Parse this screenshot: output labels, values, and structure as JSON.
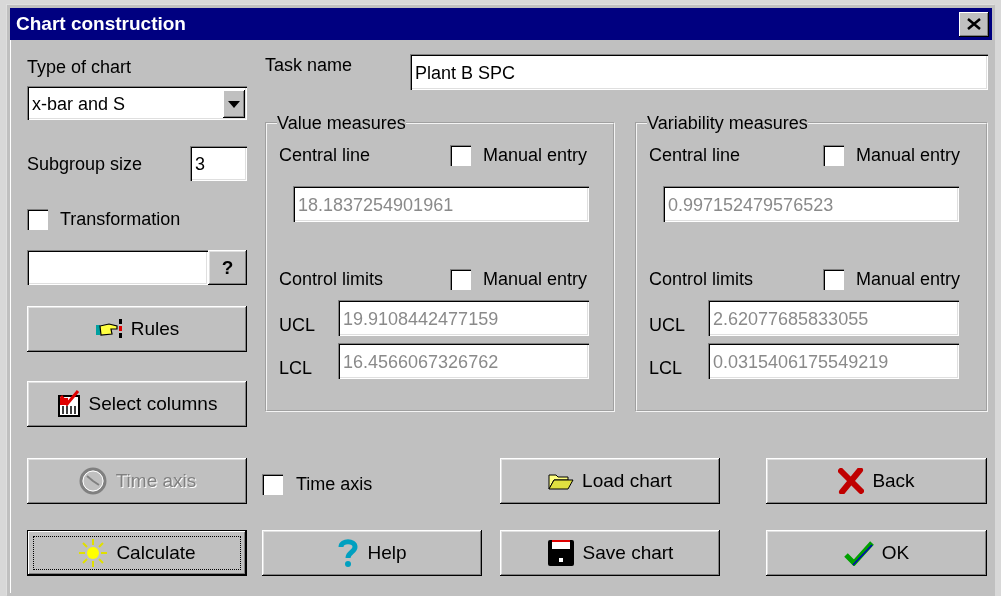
{
  "window": {
    "title": "Chart construction"
  },
  "chart_type": {
    "label": "Type of chart",
    "value": "x-bar and S"
  },
  "subgroup_size": {
    "label": "Subgroup size",
    "value": "3"
  },
  "transformation": {
    "label": "Transformation",
    "checked": false,
    "help": "?"
  },
  "side_buttons": [
    {
      "label": "Rules"
    },
    {
      "label": "Select columns"
    }
  ],
  "task_name": {
    "label": "Task name",
    "value": "Plant B SPC"
  },
  "groups": [
    {
      "title": "Value measures",
      "central_line": "Central line",
      "central_manual": {
        "label": "Manual entry",
        "checked": false
      },
      "central_value": "18.1837254901961",
      "control_limits": "Control limits",
      "limits_manual": {
        "label": "Manual entry",
        "checked": false
      },
      "ucl_label": "UCL",
      "ucl": "19.9108442477159",
      "lcl_label": "LCL",
      "lcl": "16.4566067326762",
      "disabled": true
    },
    {
      "title": "Variability measures",
      "central_line": "Central line",
      "central_manual": {
        "label": "Manual entry",
        "checked": false
      },
      "central_value": "0.997152479576523",
      "control_limits": "Control limits",
      "limits_manual": {
        "label": "Manual entry",
        "checked": false
      },
      "ucl_label": "UCL",
      "ucl": "2.62077685833055",
      "lcl_label": "LCL",
      "lcl": "0.0315406175549219",
      "disabled": true
    }
  ],
  "actions": [
    {
      "kind": "button",
      "label": "Time axis",
      "disabled": true,
      "focused": false
    },
    {
      "kind": "checkbox",
      "label": "Time axis",
      "checked": false
    },
    {
      "kind": "button",
      "label": "Load chart",
      "disabled": false,
      "focused": false
    },
    {
      "kind": "button",
      "label": "Back",
      "disabled": false,
      "focused": false
    },
    {
      "kind": "button",
      "label": "Calculate",
      "disabled": false,
      "focused": true
    },
    {
      "kind": "button",
      "label": "Help",
      "disabled": false,
      "focused": false
    },
    {
      "kind": "button",
      "label": "Save chart",
      "disabled": false,
      "focused": false
    },
    {
      "kind": "button",
      "label": "OK",
      "disabled": false,
      "focused": false
    }
  ]
}
